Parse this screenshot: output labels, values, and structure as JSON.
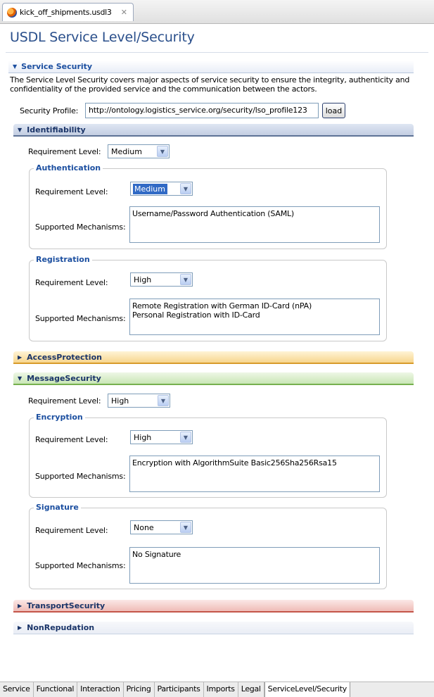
{
  "editor_tab": {
    "file_name": "kick_off_shipments.usdl3",
    "close_glyph": "✕"
  },
  "page_title": "USDL Service Level/Security",
  "service_security": {
    "title": "Service Security",
    "description": "The Service Level Security covers major aspects of service security to ensure the integrity, authenticity and confidentiality of the provided service and the communication between the actors.",
    "profile_label": "Security Profile:",
    "profile_value": "http://ontology.logistics_service.org/security/lso_profile123",
    "load_label": "load"
  },
  "labels": {
    "requirement_level": "Requirement Level:",
    "supported_mechanisms": "Supported Mechanisms:"
  },
  "sections": {
    "identifiability": {
      "title": "Identifiability",
      "expanded": true,
      "requirement_level": "Medium",
      "authentication": {
        "title": "Authentication",
        "requirement_level": "Medium",
        "mechanisms": "Username/Password Authentication (SAML)"
      },
      "registration": {
        "title": "Registration",
        "requirement_level": "High",
        "mechanisms_line1": "Remote Registration with German ID-Card (nPA)",
        "mechanisms_line2": "Personal Registration with ID-Card"
      }
    },
    "access_protection": {
      "title": "AccessProtection",
      "expanded": false
    },
    "message_security": {
      "title": "MessageSecurity",
      "expanded": true,
      "requirement_level": "High",
      "encryption": {
        "title": "Encryption",
        "requirement_level": "High",
        "mechanisms": "Encryption with AlgorithmSuite Basic256Sha256Rsa15"
      },
      "signature": {
        "title": "Signature",
        "requirement_level": "None",
        "mechanisms": "No Signature"
      }
    },
    "transport_security": {
      "title": "TransportSecurity",
      "expanded": false
    },
    "non_repudation": {
      "title": "NonRepudation",
      "expanded": false
    }
  },
  "icons": {
    "expanded": "▼",
    "collapsed": "▶",
    "dropdown": "▼"
  },
  "bottom_tabs": [
    "Service",
    "Functional",
    "Interaction",
    "Pricing",
    "Participants",
    "Imports",
    "Legal",
    "ServiceLevel/Security"
  ],
  "active_tab": "ServiceLevel/Security",
  "colors": {
    "title": "#2a4f8b",
    "group_title": "#1c4fa0",
    "identifiability_header": "#c3cee2",
    "access_protection_header": "#f7d58e",
    "message_security_header": "#c9e6b5",
    "transport_security_header": "#efbcb7"
  }
}
